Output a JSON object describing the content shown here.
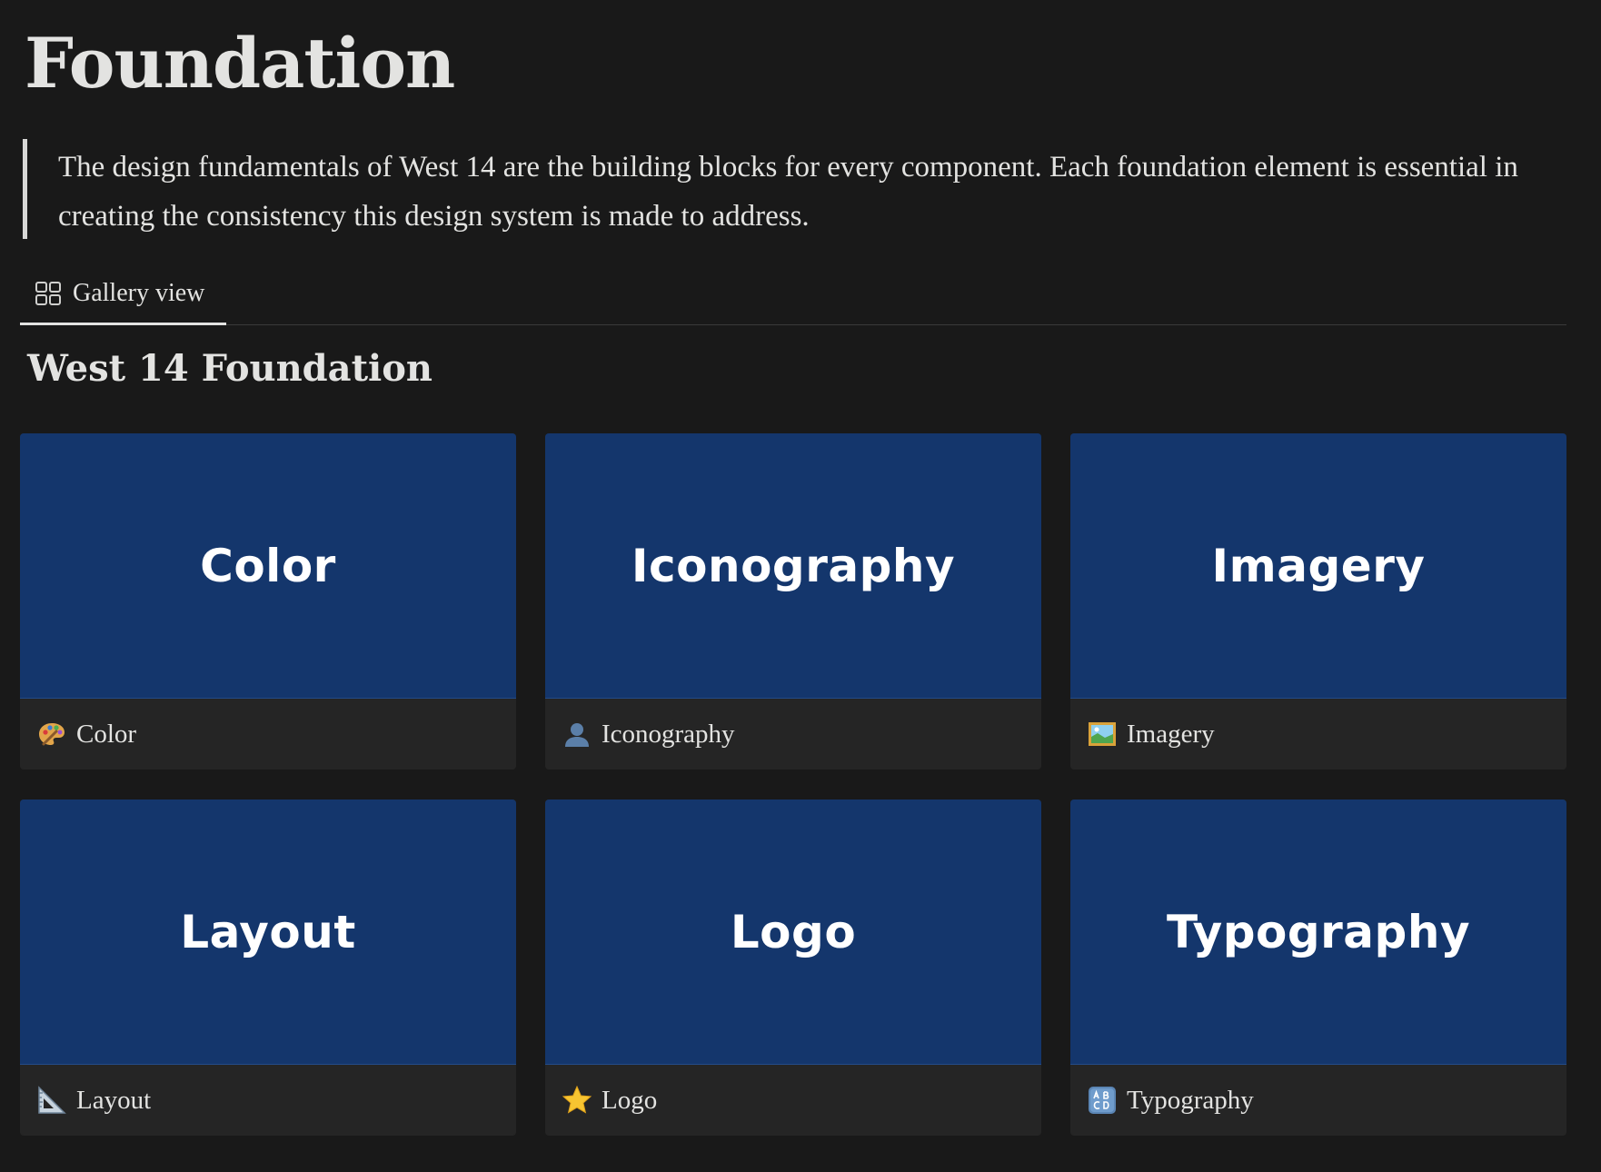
{
  "page": {
    "title": "Foundation",
    "description": "The design fundamentals of West 14 are the building blocks for every component. Each foundation element is essential in creating the consistency this design system is made to address."
  },
  "view_tab": {
    "label": "Gallery view",
    "icon": "gallery-grid-icon"
  },
  "section": {
    "title": "West 14 Foundation"
  },
  "theme": {
    "background": "#191919",
    "card_cover": "#14366c",
    "card_footer": "#252525"
  },
  "cards": [
    {
      "cover_text": "Color",
      "title": "Color",
      "icon": "palette-icon"
    },
    {
      "cover_text": "Iconography",
      "title": "Iconography",
      "icon": "user-silhouette-icon"
    },
    {
      "cover_text": "Imagery",
      "title": "Imagery",
      "icon": "framed-picture-icon"
    },
    {
      "cover_text": "Layout",
      "title": "Layout",
      "icon": "triangular-ruler-icon"
    },
    {
      "cover_text": "Logo",
      "title": "Logo",
      "icon": "star-icon"
    },
    {
      "cover_text": "Typography",
      "title": "Typography",
      "icon": "abcd-input-icon"
    }
  ]
}
